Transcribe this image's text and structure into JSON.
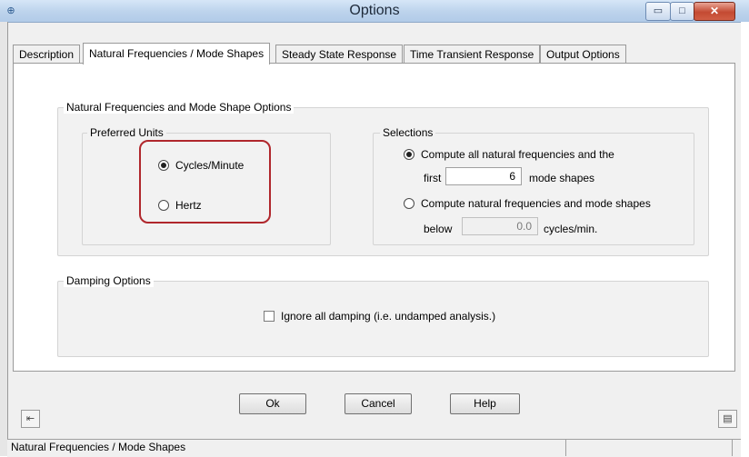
{
  "window": {
    "title": "Options",
    "minimize": "▭",
    "maximize": "□",
    "close": "✕"
  },
  "tabs": [
    {
      "label": "Description"
    },
    {
      "label": "Natural Frequencies / Mode Shapes",
      "active": true
    },
    {
      "label": "Steady State Response"
    },
    {
      "label": "Time Transient Response"
    },
    {
      "label": "Output Options"
    }
  ],
  "nat_group": {
    "legend": "Natural Frequencies and Mode Shape Options",
    "units": {
      "legend": "Preferred Units",
      "options": [
        {
          "label": "Cycles/Minute",
          "selected": true
        },
        {
          "label": "Hertz",
          "selected": false
        }
      ]
    },
    "selections": {
      "legend": "Selections",
      "option1": {
        "label": "Compute all natural frequencies and the",
        "selected": true,
        "prefix": "first",
        "value": "6",
        "suffix": "mode shapes"
      },
      "option2": {
        "label": "Compute natural frequencies and mode shapes",
        "selected": false,
        "prefix": "below",
        "value": "0.0",
        "suffix": "cycles/min."
      }
    }
  },
  "damping_group": {
    "legend": "Damping Options",
    "checkbox": {
      "label": "Ignore all damping (i.e. undamped analysis.)",
      "checked": false
    }
  },
  "buttons": {
    "ok": "Ok",
    "cancel": "Cancel",
    "help": "Help"
  },
  "icons": {
    "left": "pin-icon",
    "right": "clipboard-icon",
    "app": "app-icon"
  },
  "status": {
    "text": "Natural Frequencies / Mode Shapes"
  },
  "colors": {
    "highlight": "#b0272c",
    "titlebar": "#bcd3ec"
  }
}
